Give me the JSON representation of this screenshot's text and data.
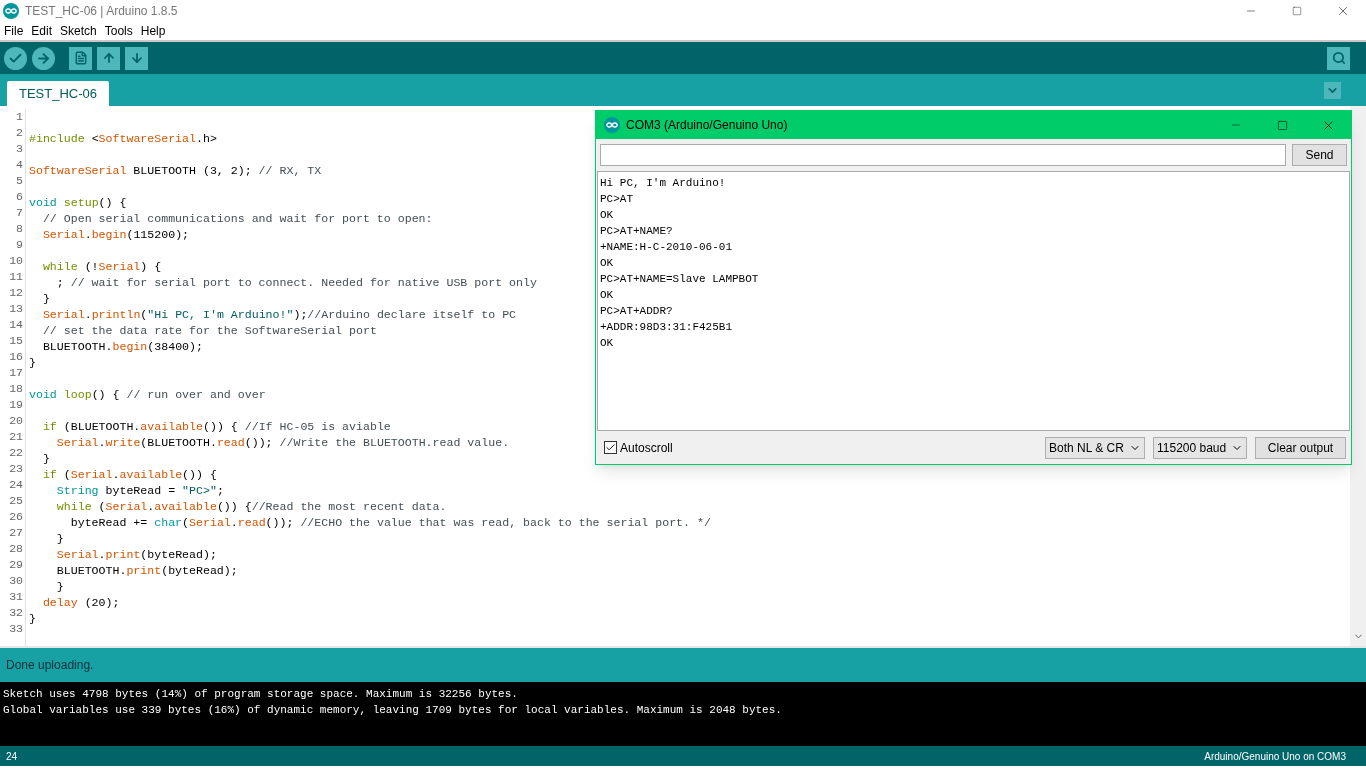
{
  "window": {
    "title": "TEST_HC-06 | Arduino 1.8.5"
  },
  "menu": [
    "File",
    "Edit",
    "Sketch",
    "Tools",
    "Help"
  ],
  "tabs": [
    {
      "label": "TEST_HC-06",
      "selected": true
    }
  ],
  "editor": {
    "lines": [
      {
        "number": "1"
      },
      {
        "number": "2",
        "tokens": [
          {
            "kind": "keyword",
            "text": "#include"
          },
          {
            "kind": "plain",
            "text": " <"
          },
          {
            "kind": "function",
            "text": "SoftwareSerial"
          },
          {
            "kind": "plain",
            "text": ".h>"
          }
        ]
      },
      {
        "number": "3"
      },
      {
        "number": "4",
        "tokens": [
          {
            "kind": "function",
            "text": "SoftwareSerial"
          },
          {
            "kind": "plain",
            "text": " BLUETOOTH (3, 2); "
          },
          {
            "kind": "comment",
            "text": "// RX, TX"
          }
        ]
      },
      {
        "number": "5"
      },
      {
        "number": "6",
        "tokens": [
          {
            "kind": "type",
            "text": "void"
          },
          {
            "kind": "keyword",
            "text": " setup"
          },
          {
            "kind": "plain",
            "text": "() {"
          }
        ]
      },
      {
        "number": "7",
        "tokens": [
          {
            "kind": "comment",
            "text": "  // Open serial communications and wait for port to open:"
          }
        ]
      },
      {
        "number": "8",
        "tokens": [
          {
            "kind": "function",
            "text": "  Serial"
          },
          {
            "kind": "plain",
            "text": "."
          },
          {
            "kind": "function",
            "text": "begin"
          },
          {
            "kind": "plain",
            "text": "(115200);"
          }
        ]
      },
      {
        "number": "9"
      },
      {
        "number": "10",
        "tokens": [
          {
            "kind": "keyword",
            "text": "  while"
          },
          {
            "kind": "plain",
            "text": " (!"
          },
          {
            "kind": "function",
            "text": "Serial"
          },
          {
            "kind": "plain",
            "text": ") {"
          }
        ]
      },
      {
        "number": "11",
        "tokens": [
          {
            "kind": "plain",
            "text": "    ; "
          },
          {
            "kind": "comment",
            "text": "// wait for serial port to connect. Needed for native USB port only"
          }
        ]
      },
      {
        "number": "12",
        "tokens": [
          {
            "kind": "plain",
            "text": "  }"
          }
        ]
      },
      {
        "number": "13",
        "tokens": [
          {
            "kind": "function",
            "text": "  Serial"
          },
          {
            "kind": "plain",
            "text": "."
          },
          {
            "kind": "function",
            "text": "println"
          },
          {
            "kind": "plain",
            "text": "("
          },
          {
            "kind": "string",
            "text": "\"Hi PC, I'm Arduino!\""
          },
          {
            "kind": "plain",
            "text": ");"
          },
          {
            "kind": "comment",
            "text": "//Arduino declare itself to PC"
          }
        ]
      },
      {
        "number": "14",
        "tokens": [
          {
            "kind": "comment",
            "text": "  // set the data rate for the SoftwareSerial port"
          }
        ]
      },
      {
        "number": "15",
        "tokens": [
          {
            "kind": "plain",
            "text": "  BLUETOOTH."
          },
          {
            "kind": "function",
            "text": "begin"
          },
          {
            "kind": "plain",
            "text": "(38400);"
          }
        ]
      },
      {
        "number": "16",
        "tokens": [
          {
            "kind": "plain",
            "text": "}"
          }
        ]
      },
      {
        "number": "17"
      },
      {
        "number": "18",
        "tokens": [
          {
            "kind": "type",
            "text": "void"
          },
          {
            "kind": "keyword",
            "text": " loop"
          },
          {
            "kind": "plain",
            "text": "() { "
          },
          {
            "kind": "comment",
            "text": "// run over and over"
          }
        ]
      },
      {
        "number": "19"
      },
      {
        "number": "20",
        "tokens": [
          {
            "kind": "keyword",
            "text": "  if"
          },
          {
            "kind": "plain",
            "text": " (BLUETOOTH."
          },
          {
            "kind": "function",
            "text": "available"
          },
          {
            "kind": "plain",
            "text": "()) { "
          },
          {
            "kind": "comment",
            "text": "//If HC-05 is aviable"
          }
        ]
      },
      {
        "number": "21",
        "tokens": [
          {
            "kind": "function",
            "text": "    Serial"
          },
          {
            "kind": "plain",
            "text": "."
          },
          {
            "kind": "function",
            "text": "write"
          },
          {
            "kind": "plain",
            "text": "(BLUETOOTH."
          },
          {
            "kind": "function",
            "text": "read"
          },
          {
            "kind": "plain",
            "text": "()); "
          },
          {
            "kind": "comment",
            "text": "//Write the BLUETOOTH.read value."
          }
        ]
      },
      {
        "number": "22",
        "tokens": [
          {
            "kind": "plain",
            "text": "  }"
          }
        ]
      },
      {
        "number": "23",
        "tokens": [
          {
            "kind": "keyword",
            "text": "  if"
          },
          {
            "kind": "plain",
            "text": " ("
          },
          {
            "kind": "function",
            "text": "Serial"
          },
          {
            "kind": "plain",
            "text": "."
          },
          {
            "kind": "function",
            "text": "available"
          },
          {
            "kind": "plain",
            "text": "()) {"
          }
        ]
      },
      {
        "number": "24",
        "tokens": [
          {
            "kind": "type",
            "text": "    String"
          },
          {
            "kind": "plain",
            "text": " byteRead = "
          },
          {
            "kind": "string",
            "text": "\"PC>\""
          },
          {
            "kind": "plain",
            "text": ";"
          }
        ]
      },
      {
        "number": "25",
        "tokens": [
          {
            "kind": "keyword",
            "text": "    while"
          },
          {
            "kind": "plain",
            "text": " ("
          },
          {
            "kind": "function",
            "text": "Serial"
          },
          {
            "kind": "plain",
            "text": "."
          },
          {
            "kind": "function",
            "text": "available"
          },
          {
            "kind": "plain",
            "text": "()) {"
          },
          {
            "kind": "comment",
            "text": "//Read the most recent data."
          }
        ]
      },
      {
        "number": "26",
        "tokens": [
          {
            "kind": "plain",
            "text": "      byteRead += "
          },
          {
            "kind": "type",
            "text": "char"
          },
          {
            "kind": "plain",
            "text": "("
          },
          {
            "kind": "function",
            "text": "Serial"
          },
          {
            "kind": "plain",
            "text": "."
          },
          {
            "kind": "function",
            "text": "read"
          },
          {
            "kind": "plain",
            "text": "()); "
          },
          {
            "kind": "comment",
            "text": "//ECHO the value that was read, back to the serial port. */"
          }
        ]
      },
      {
        "number": "27",
        "tokens": [
          {
            "kind": "plain",
            "text": "    }"
          }
        ]
      },
      {
        "number": "28",
        "tokens": [
          {
            "kind": "function",
            "text": "    Serial"
          },
          {
            "kind": "plain",
            "text": "."
          },
          {
            "kind": "function",
            "text": "print"
          },
          {
            "kind": "plain",
            "text": "(byteRead);"
          }
        ]
      },
      {
        "number": "29",
        "tokens": [
          {
            "kind": "plain",
            "text": "    BLUETOOTH."
          },
          {
            "kind": "function",
            "text": "print"
          },
          {
            "kind": "plain",
            "text": "(byteRead);"
          }
        ]
      },
      {
        "number": "30",
        "tokens": [
          {
            "kind": "plain",
            "text": "    }"
          }
        ]
      },
      {
        "number": "31",
        "tokens": [
          {
            "kind": "function",
            "text": "  delay"
          },
          {
            "kind": "plain",
            "text": " (20);"
          }
        ]
      },
      {
        "number": "32",
        "tokens": [
          {
            "kind": "plain",
            "text": "}"
          }
        ]
      },
      {
        "number": "33"
      }
    ]
  },
  "serial_monitor": {
    "title": "COM3 (Arduino/Genuino Uno)",
    "send_button": "Send",
    "output": [
      "Hi PC, I'm Arduino!",
      "PC>AT",
      "OK",
      "PC>AT+NAME?",
      "+NAME:H-C-2010-06-01",
      "OK",
      "PC>AT+NAME=Slave LAMPBOT",
      "OK",
      "PC>AT+ADDR?",
      "+ADDR:98D3:31:F425B1",
      "OK"
    ],
    "autoscroll": {
      "label": "Autoscroll",
      "checked": true
    },
    "line_ending": "Both NL & CR",
    "baud_rate": "115200 baud",
    "clear_button": "Clear output"
  },
  "status": {
    "message": "Done uploading."
  },
  "console": [
    "Sketch uses 4798 bytes (14%) of program storage space. Maximum is 32256 bytes.",
    "Global variables use 339 bytes (16%) of dynamic memory, leaving 1709 bytes for local variables. Maximum is 2048 bytes."
  ],
  "footer": {
    "line": "24",
    "board": "Arduino/Genuino Uno on COM3"
  }
}
